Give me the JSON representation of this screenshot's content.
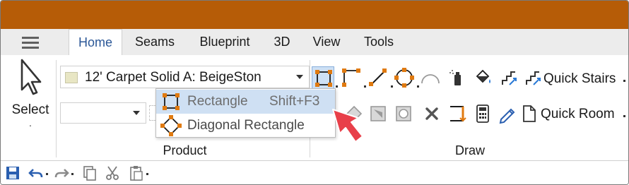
{
  "tabs": [
    {
      "label": "Home",
      "active": true
    },
    {
      "label": "Seams",
      "active": false
    },
    {
      "label": "Blueprint",
      "active": false
    },
    {
      "label": "3D",
      "active": false
    },
    {
      "label": "View",
      "active": false
    },
    {
      "label": "Tools",
      "active": false
    }
  ],
  "select_tool": {
    "label": "Select",
    "dropdown_glyph": "·"
  },
  "product": {
    "combo_value": "12' Carpet Solid A: BeigeSton",
    "swatch_color": "#e8e6c4",
    "group_label": "Product"
  },
  "draw": {
    "group_label": "Draw"
  },
  "quick_stairs": {
    "label": "Quick Stairs"
  },
  "quick_room": {
    "label": "Quick Room"
  },
  "popup": {
    "items": [
      {
        "label": "Rectangle",
        "shortcut": "Shift+F3",
        "highlighted": true
      },
      {
        "label": "Diagonal Rectangle",
        "shortcut": "",
        "highlighted": false
      }
    ]
  },
  "colors": {
    "title_bar": "#b65c07",
    "accent_orange": "#e07a10",
    "active_tab_text": "#2b5797",
    "pointer_arrow": "#e8404a"
  }
}
